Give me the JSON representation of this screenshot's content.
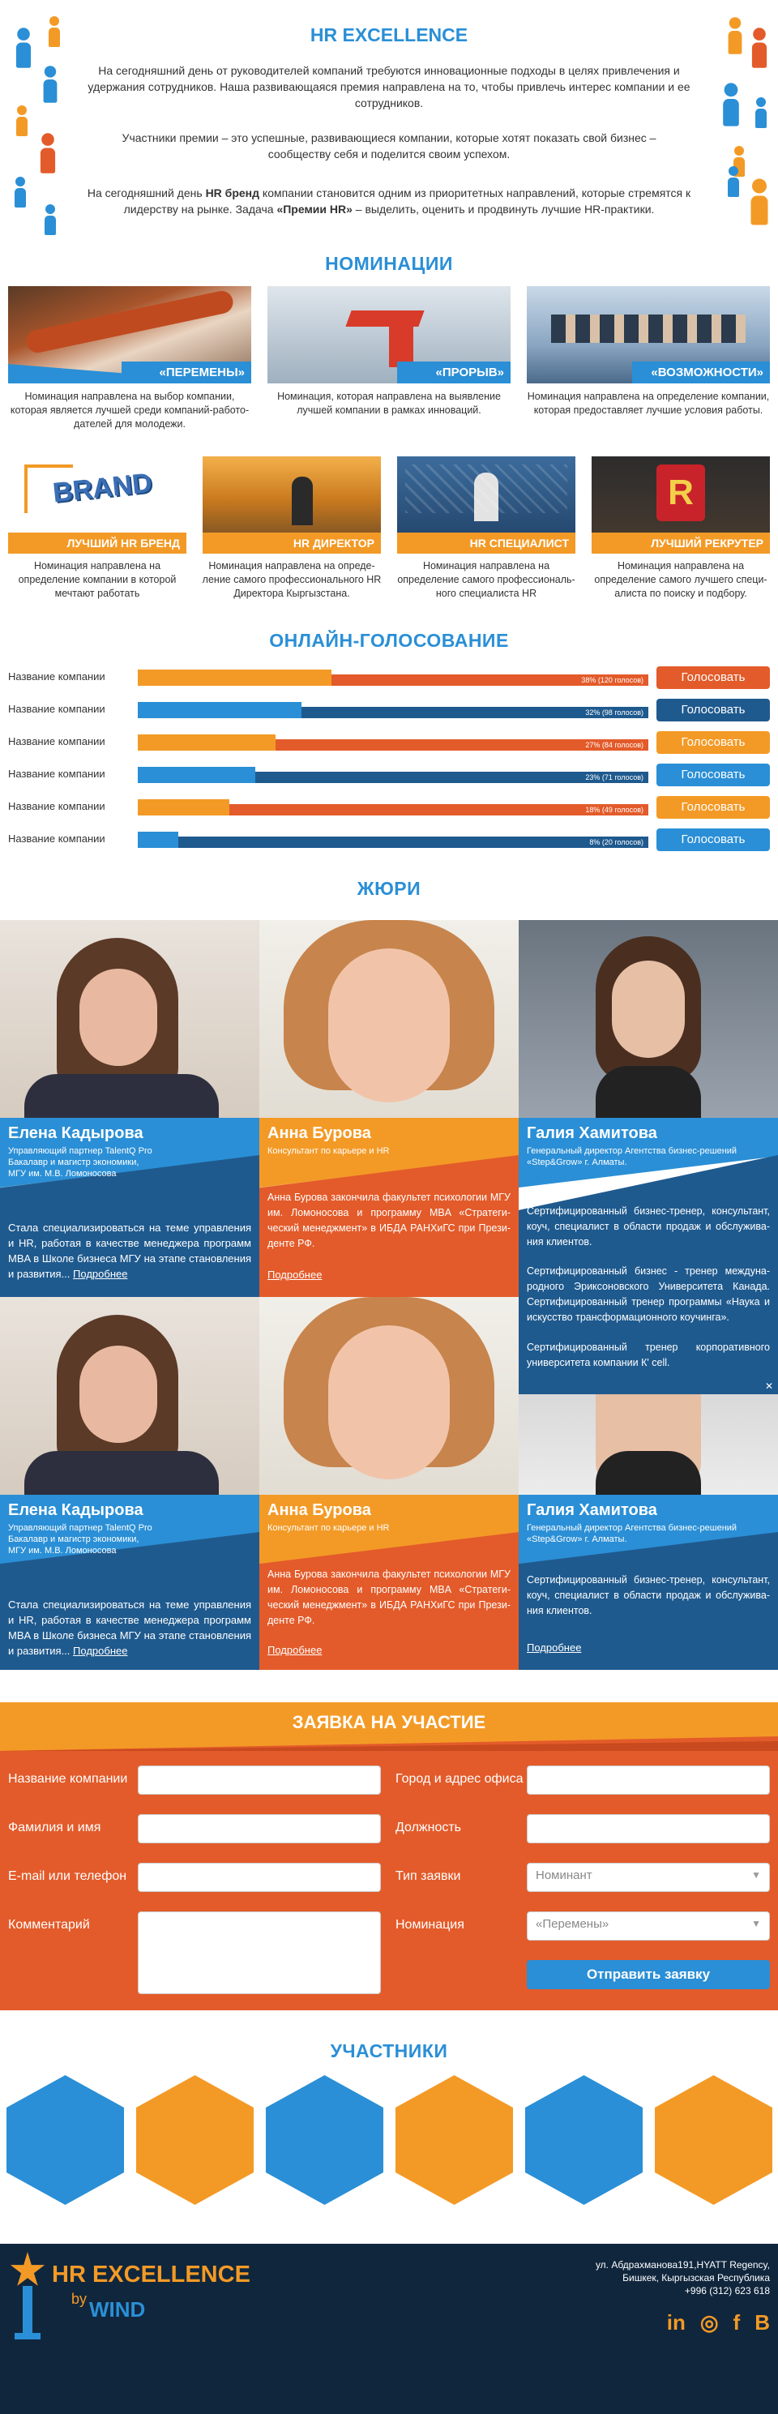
{
  "intro": {
    "title": "HR EXCELLENCE",
    "p1": "На сегодняшний день от руководителей компаний требуются инновационные подходы в целях привлечения и удержания сотрудников. Наша развивающаяся премия направлена на то, чтобы привлечь интерес компании и ее сотрудников.",
    "p2": "Участники премии – это успешные, развивающиеся компании, которые хотят показать свой бизнес – сообще­ству себя и поделится своим успехом.",
    "p3_a": "На сегодняшний день ",
    "p3_b": "HR бренд",
    "p3_c": " компании становится одним из приоритетных направлений, которые стремятся к лидерству на рынке. Задача ",
    "p3_d": "«Премии HR»",
    "p3_e": " – выделить, оценить и продвинуть лучшие HR-практики."
  },
  "nominations": {
    "title": "НОМИНАЦИИ",
    "row1": [
      {
        "label": "«ПЕРЕМЕНЫ»",
        "desc": "Номинация направлена на выбор компании, которая является лучшей среди компаний-работо­дателей для молодежи."
      },
      {
        "label": "«ПРОРЫВ»",
        "desc": "Номинация, которая направлена на выявление лучшей компании в рамках инноваций."
      },
      {
        "label": "«ВОЗМОЖНОСТИ»",
        "desc": "Номинация направлена на определение компа­нии, которая предоставляет лучшие условия работы."
      }
    ],
    "row2": [
      {
        "label": "ЛУЧШИЙ HR БРЕНД",
        "desc": "Номинация направлена на определение компании в которой мечтают работать"
      },
      {
        "label": "HR ДИРЕКТОР",
        "desc": "Номинация направлена на опреде­ление самого профессионального HR Директора Кыргызстана."
      },
      {
        "label": "HR СПЕЦИАЛИСТ",
        "desc": "Номинация направлена на определение самого профессиональ­ного специалиста HR"
      },
      {
        "label": "ЛУЧШИЙ РЕКРУТЕР",
        "desc": "Номинация направлена на определение самого лучшего специ­алиста по поиску и подбору."
      }
    ],
    "brand_word": "BRAND"
  },
  "voting": {
    "title": "ОНЛАЙН-ГОЛОСОВАНИЕ",
    "rows": [
      {
        "name": "Название  компании",
        "percent": 38,
        "text": "38% (120 голосов)",
        "button": "Голосовать",
        "scheme": "orange"
      },
      {
        "name": "Название  компании",
        "percent": 32,
        "text": "32% (98 голосов)",
        "button": "Голосовать",
        "scheme": "blue"
      },
      {
        "name": "Название  компании",
        "percent": 27,
        "text": "27% (84 голосов)",
        "button": "Голосовать",
        "scheme": "orange"
      },
      {
        "name": "Название  компании",
        "percent": 23,
        "text": "23% (71 голосов)",
        "button": "Голосовать",
        "scheme": "blue"
      },
      {
        "name": "Название  компании",
        "percent": 18,
        "text": "18% (49 голосов)",
        "button": "Голосовать",
        "scheme": "orange"
      },
      {
        "name": "Название  компании",
        "percent": 8,
        "text": "8% (20 голосов)",
        "button": "Голосовать",
        "scheme": "blue"
      }
    ]
  },
  "jury": {
    "title": "ЖЮРИ",
    "elena": {
      "name": "Елена Кадырова",
      "position": "Управляющий партнер TalentQ Pro\nБакалавр и магистр экономики,\nМГУ им. М.В. Ломоносова",
      "text": "Стала специализироваться на теме управления и HR, работая в качестве менеджера программ MBA в Школе бизнеса МГУ на этапе становления и развития...",
      "more": "Подробнее"
    },
    "anna": {
      "name": "Анна Бурова",
      "position": "Консультант по карьере и HR",
      "text": "Анна Бурова закончила факультет психологии МГУ им. Ломоносова и программу MBA «Стратеги­ческий менеджмент» в ИБДА РАНХиГС при Прези­денте РФ.",
      "more": "Подробнее"
    },
    "galia": {
      "name": "Галия Хамитова",
      "position": "Генеральный директор Агентства бизнес-решений «Step&Grow» г. Алматы.",
      "text_short": "Сертифицированный бизнес-тренер, консультант, коуч, специалист в области продаж и обслужива­ния клиентов.",
      "text_full_2": "Сертифицированный бизнес - тренер междуна­родного Эриксоновского Университета Канада. Сертифицированный тренер программы «Наука и искусство трансформационного коучинга».",
      "text_full_3": "Сертифицированный тренер корпоративного университета компании К' cell.",
      "more": "Подробнее",
      "close": "✕"
    }
  },
  "form": {
    "title": "ЗАЯВКА НА УЧАСТИЕ",
    "company_label": "Название компании",
    "city_label": "Город и адрес офиса",
    "fio_label": "Фамилия и имя",
    "post_label": "Должность",
    "contact_label": "E-mail или телефон",
    "type_label": "Тип заявки",
    "type_value": "Номинант",
    "comment_label": "Комментарий",
    "nomination_label": "Номинация",
    "nomination_value": "«Перемены»",
    "submit": "Отправить заявку"
  },
  "participants": {
    "title": "УЧАСТНИКИ",
    "hex_colors": [
      "#2a8fd6",
      "#f39a26",
      "#2a8fd6",
      "#f39a26",
      "#2a8fd6",
      "#f39a26"
    ]
  },
  "footer": {
    "logo_main": "HR EXCELLENCE",
    "logo_by": "by",
    "logo_wind": "WIND",
    "address1": "ул. Абдрахманова191,HYATT Regency,",
    "address2": "Бишкек, Кыргызская Республика",
    "phone": "+996 (312) 623 618",
    "social": [
      "in",
      "◎",
      "f",
      "B"
    ]
  },
  "colors": {
    "blue": "#2a8fd6",
    "dark_blue": "#1f5a8e",
    "orange": "#f39a26",
    "red_orange": "#e35b2a",
    "navy": "#10263d"
  }
}
